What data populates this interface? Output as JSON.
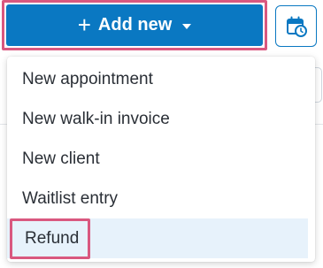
{
  "toolbar": {
    "add_new_label": "Add new",
    "add_icon": "plus-icon",
    "dropdown_icon": "caret-down-icon",
    "calendar_icon": "calendar-clock-icon"
  },
  "menu": {
    "items": [
      {
        "label": "New appointment"
      },
      {
        "label": "New walk-in invoice"
      },
      {
        "label": "New client"
      },
      {
        "label": "Waitlist entry"
      },
      {
        "label": "Refund"
      }
    ]
  },
  "colors": {
    "primary": "#0a78c2",
    "highlight": "#d9587f",
    "hover": "#e7f2fb"
  }
}
